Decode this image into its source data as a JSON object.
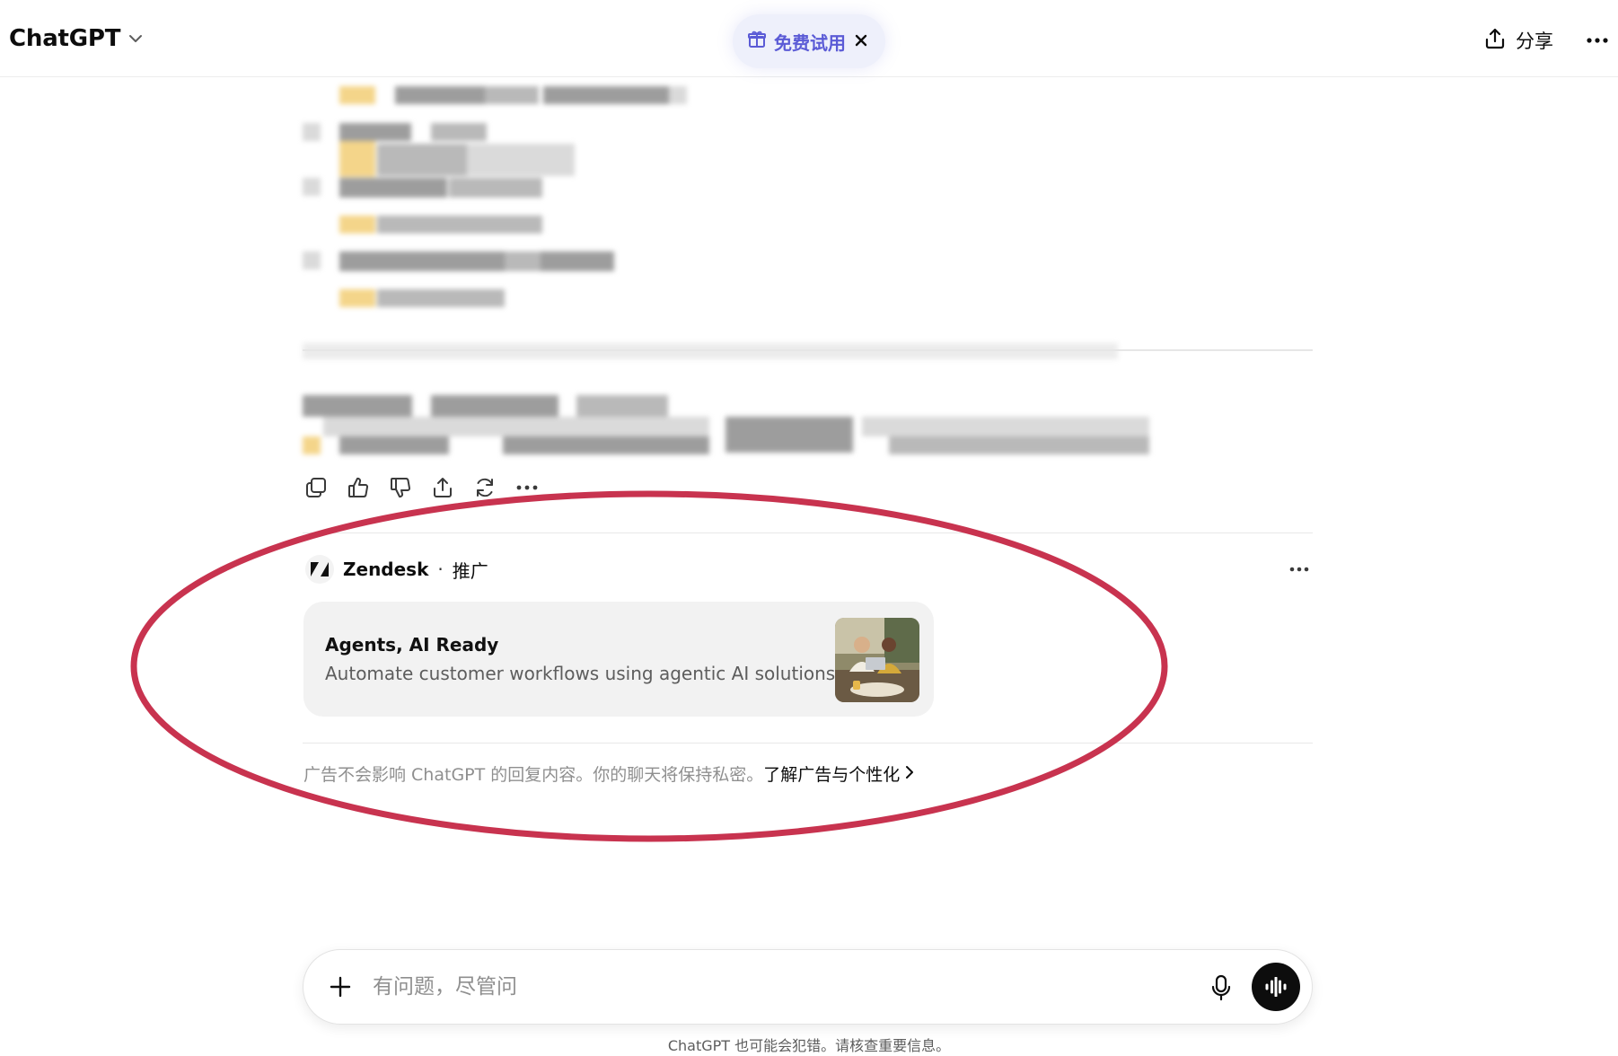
{
  "header": {
    "model_name": "ChatGPT",
    "trial_label": "免费试用",
    "share_label": "分享"
  },
  "ad": {
    "brand": "Zendesk",
    "separator": "·",
    "sponsored": "推广",
    "card_title": "Agents, AI Ready",
    "card_description": "Automate customer workflows using agentic AI solutions",
    "note": "广告不会影响 ChatGPT 的回复内容。你的聊天将保持私密。",
    "learn_more": "了解广告与个性化"
  },
  "composer": {
    "placeholder": "有问题，尽管问",
    "value": ""
  },
  "disclaimer": "ChatGPT 也可能会犯错。请核查重要信息。",
  "colors": {
    "accent": "#5b5bd6",
    "annotation": "#c8334f",
    "voice_button": "#0d0d0d"
  },
  "icons": {
    "actions": [
      "copy-icon",
      "thumbs-up-icon",
      "thumbs-down-icon",
      "share-icon",
      "regenerate-icon",
      "more-icon"
    ]
  }
}
